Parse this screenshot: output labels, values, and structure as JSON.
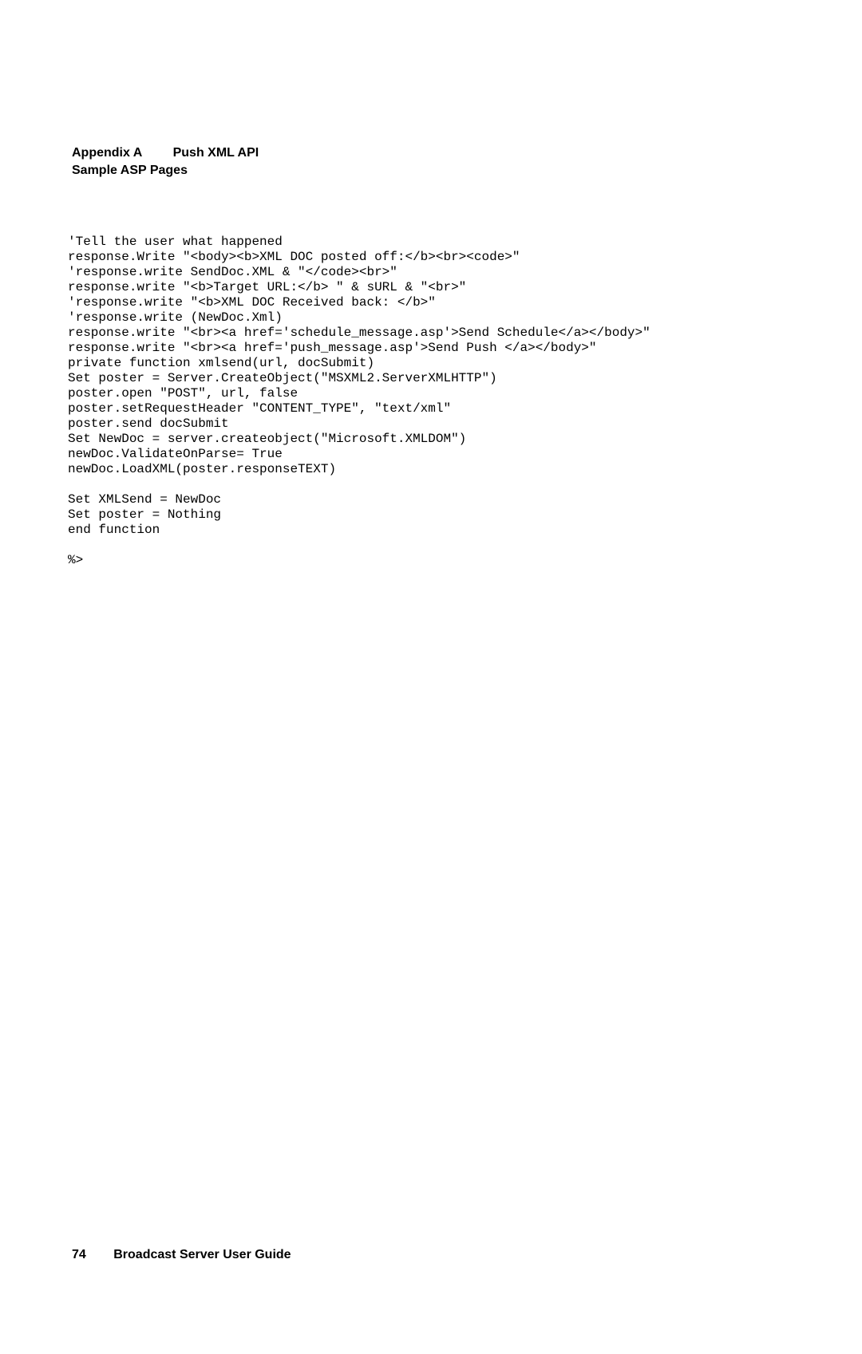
{
  "header": {
    "appendix": "Appendix A",
    "title": "Push XML API",
    "subtitle": "Sample ASP Pages"
  },
  "code": {
    "lines": [
      "'Tell the user what happened",
      "response.Write \"<body><b>XML DOC posted off:</b><br><code>\"",
      "'response.write SendDoc.XML & \"</code><br>\"",
      "response.write \"<b>Target URL:</b> \" & sURL & \"<br>\"",
      "'response.write \"<b>XML DOC Received back: </b>\"",
      "'response.write (NewDoc.Xml)",
      "response.write \"<br><a href='schedule_message.asp'>Send Schedule</a></body>\"",
      "response.write \"<br><a href='push_message.asp'>Send Push </a></body>\"",
      "private function xmlsend(url, docSubmit)",
      "Set poster = Server.CreateObject(\"MSXML2.ServerXMLHTTP\")",
      "poster.open \"POST\", url, false",
      "poster.setRequestHeader \"CONTENT_TYPE\", \"text/xml\"",
      "poster.send docSubmit",
      "Set NewDoc = server.createobject(\"Microsoft.XMLDOM\")",
      "newDoc.ValidateOnParse= True",
      "newDoc.LoadXML(poster.responseTEXT)",
      "",
      "Set XMLSend = NewDoc",
      "Set poster = Nothing",
      "end function",
      "",
      "%>"
    ]
  },
  "footer": {
    "page_number": "74",
    "guide_title": "Broadcast Server User Guide"
  }
}
